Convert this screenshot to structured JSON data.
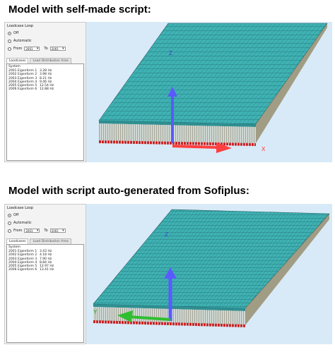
{
  "headings": {
    "top": "Model with self-made script:",
    "bottom": "Model with script auto-generated from Sofiplus:"
  },
  "panels": [
    {
      "group_title": "Loadcase Loop",
      "options": [
        "Off",
        "Automatic",
        "From"
      ],
      "selected_option": "Off",
      "from_value": "2001",
      "to_label": "To",
      "to_value": "2001",
      "tabs": [
        "Loadcases",
        "Load Distribution Area"
      ],
      "active_tab": "Loadcases",
      "list_header": "System",
      "rows": [
        {
          "label": "2001 Eigenform  1",
          "value": "3.28 Hz"
        },
        {
          "label": "2002 Eigenform  2",
          "value": "3.98 Hz"
        },
        {
          "label": "2003 Eigenform  3",
          "value": "8.21 Hz"
        },
        {
          "label": "2004 Eigenform  4",
          "value": "9.46 Hz"
        },
        {
          "label": "2005 Eigenform  5",
          "value": "12.54 Hz"
        },
        {
          "label": "2006 Eigenform  6",
          "value": "12.88 Hz"
        }
      ]
    },
    {
      "group_title": "Loadcase Loop",
      "options": [
        "Off",
        "Automatic",
        "From"
      ],
      "selected_option": "Off",
      "from_value": "2001",
      "to_label": "To",
      "to_value": "2001",
      "tabs": [
        "Loadcases",
        "Load Distribution Area"
      ],
      "active_tab": "Loadcases",
      "list_header": "System",
      "rows": [
        {
          "label": "2001 Eigenform  1",
          "value": "3.43 Hz"
        },
        {
          "label": "2002 Eigenform  2",
          "value": "4.18 Hz"
        },
        {
          "label": "2003 Eigenform  3",
          "value": "7.90 Hz"
        },
        {
          "label": "2004 Eigenform  4",
          "value": "8.84 Hz"
        },
        {
          "label": "2005 Eigenform  5",
          "value": "12.97 Hz"
        },
        {
          "label": "2006 Eigenform  6",
          "value": "13.41 Hz"
        }
      ]
    }
  ],
  "views": [
    {
      "axes": [
        "Z",
        "X"
      ]
    },
    {
      "axes": [
        "Z",
        "Y"
      ]
    }
  ],
  "colors": {
    "deck": "#3fb2b4",
    "mesh": "#1d5a5c",
    "background": "#d8eaf7",
    "ribs": "#6b5a3a",
    "supports": "#cc2020",
    "axis_z": "#5a5aff",
    "axis_x": "#ff4040",
    "axis_y": "#2fbf2f"
  }
}
